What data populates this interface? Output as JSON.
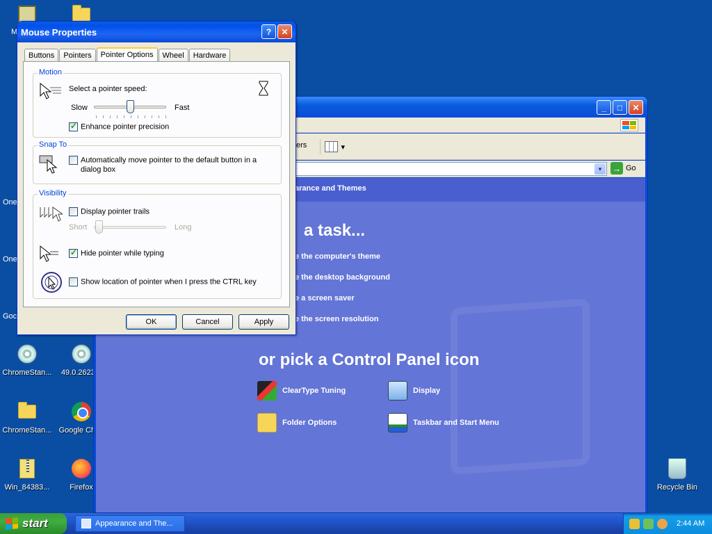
{
  "desktop": {
    "icons": [
      {
        "label": "M",
        "kind": "app"
      },
      {
        "label": "",
        "kind": "folder"
      },
      {
        "label": "One",
        "kind": "hidden"
      },
      {
        "label": "ChromeStan...",
        "kind": "cd"
      },
      {
        "label": "49.0.2623...",
        "kind": "cd"
      },
      {
        "label": "ChromeStan...",
        "kind": "folder"
      },
      {
        "label": "Google Chr...",
        "kind": "chrome"
      },
      {
        "label": "Win_84383...",
        "kind": "zip"
      },
      {
        "label": "Firefox",
        "kind": "firefox"
      },
      {
        "label": "Recycle Bin",
        "kind": "recycle"
      }
    ],
    "edge_labels": [
      "M",
      "One",
      "One",
      "Goc"
    ]
  },
  "control_panel": {
    "toolbar_folders": "ers",
    "go_label": "Go",
    "crumb": "arance and Themes",
    "task_heading": "a task...",
    "tasks": [
      "e the computer's theme",
      "e the desktop background",
      "e a screen saver",
      "e the screen resolution"
    ],
    "pick_heading": "or pick a Control Panel icon",
    "items": [
      {
        "label": "ClearType Tuning",
        "icon": "cleartype-icon"
      },
      {
        "label": "Display",
        "icon": "display-icon"
      },
      {
        "label": "Folder Options",
        "icon": "folder-options-icon"
      },
      {
        "label": "Taskbar and Start Menu",
        "icon": "taskbar-icon"
      }
    ]
  },
  "dialog": {
    "title": "Mouse Properties",
    "tabs": [
      "Buttons",
      "Pointers",
      "Pointer Options",
      "Wheel",
      "Hardware"
    ],
    "active_tab": "Pointer Options",
    "motion": {
      "title": "Motion",
      "speed_label": "Select a pointer speed:",
      "slow": "Slow",
      "fast": "Fast",
      "speed_level": 0.5,
      "precision_label": "Enhance pointer precision",
      "precision_checked": true
    },
    "snap": {
      "title": "Snap To",
      "auto_label": "Automatically move pointer to the default button in a",
      "auto_label2": "dialog box",
      "auto_checked": false
    },
    "visibility": {
      "title": "Visibility",
      "trails_label": "Display pointer trails",
      "trails_checked": false,
      "short": "Short",
      "long": "Long",
      "hide_label": "Hide pointer while typing",
      "hide_checked": true,
      "show_label": "Show location of pointer when I press the CTRL key",
      "show_checked": false
    },
    "buttons": {
      "ok": "OK",
      "cancel": "Cancel",
      "apply": "Apply"
    }
  },
  "taskbar": {
    "start": "start",
    "task_button": "Appearance and The...",
    "clock": "2:44 AM"
  }
}
